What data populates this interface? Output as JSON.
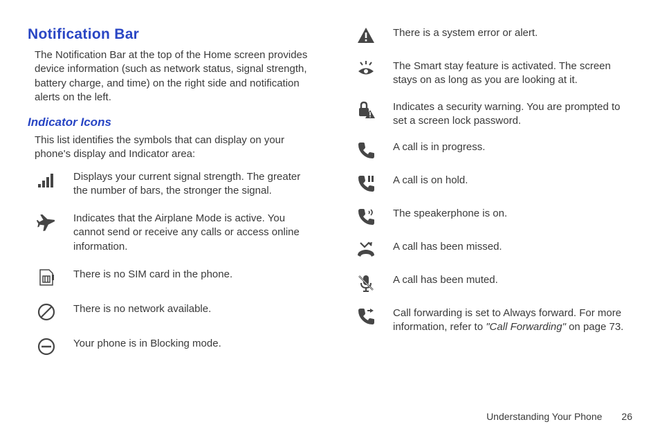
{
  "header": {
    "title": "Notification Bar",
    "intro": "The Notification Bar at the top of the Home screen provides device information (such as network status, signal strength, battery charge, and time) on the right side and notification alerts on the left."
  },
  "subsection": {
    "title": "Indicator Icons",
    "intro": "This list identifies the symbols that can display on your phone's display and Indicator area:"
  },
  "leftIcons": [
    {
      "name": "signal-strength-icon",
      "desc": "Displays your current signal strength. The greater the number of bars, the stronger the signal."
    },
    {
      "name": "airplane-mode-icon",
      "desc": "Indicates that the Airplane Mode is active. You cannot send or receive any calls or access online information."
    },
    {
      "name": "no-sim-icon",
      "desc": "There is no SIM card in the phone."
    },
    {
      "name": "no-network-icon",
      "desc": "There is no network available."
    },
    {
      "name": "blocking-mode-icon",
      "desc": "Your phone is in Blocking mode."
    }
  ],
  "rightIcons": [
    {
      "name": "system-error-icon",
      "desc": "There is a system error or alert."
    },
    {
      "name": "smart-stay-icon",
      "desc": "The Smart stay feature is activated. The screen stays on as long as you are looking at it."
    },
    {
      "name": "security-warning-icon",
      "desc": "Indicates a security warning. You are prompted to set a screen lock password."
    },
    {
      "name": "call-in-progress-icon",
      "desc": "A call is in progress."
    },
    {
      "name": "call-on-hold-icon",
      "desc": "A call is on hold."
    },
    {
      "name": "speakerphone-icon",
      "desc": "The speakerphone is on."
    },
    {
      "name": "missed-call-icon",
      "desc": "A call has been missed."
    },
    {
      "name": "call-muted-icon",
      "desc": "A call has been muted."
    },
    {
      "name": "call-forwarding-icon",
      "descPrefix": "Call forwarding is set to Always forward. For more information, refer to ",
      "descItalic": "\"Call Forwarding\"",
      "descSuffix": " on page 73."
    }
  ],
  "footer": {
    "chapter": "Understanding Your Phone",
    "page": "26"
  }
}
